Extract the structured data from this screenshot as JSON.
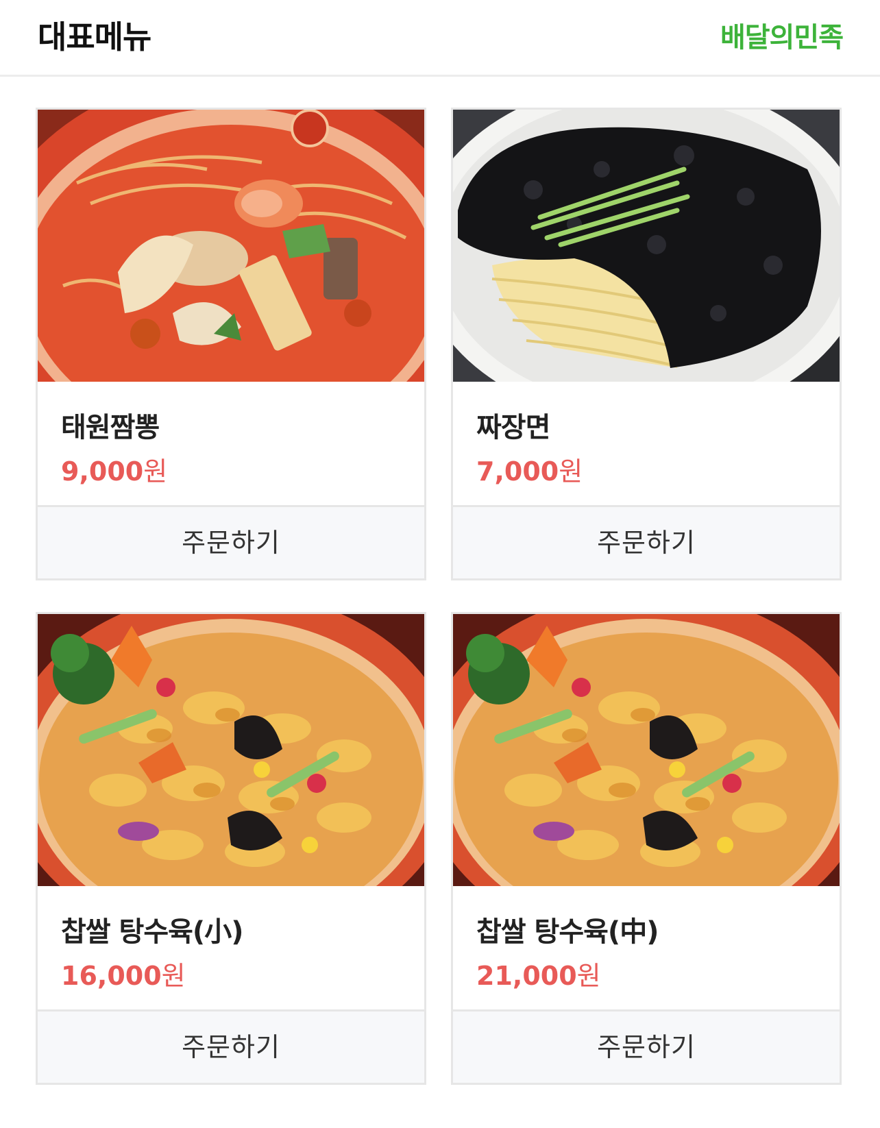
{
  "header": {
    "title": "대표메뉴",
    "brand": "배달의민족"
  },
  "menu": [
    {
      "name": "태원짬뽕",
      "price": "9,000",
      "currency": "원",
      "order_label": "주문하기",
      "photo": "jjamppong"
    },
    {
      "name": "짜장면",
      "price": "7,000",
      "currency": "원",
      "order_label": "주문하기",
      "photo": "jajangmyeon"
    },
    {
      "name": "찹쌀 탕수육(小)",
      "price": "16,000",
      "currency": "원",
      "order_label": "주문하기",
      "photo": "tangsuyuk"
    },
    {
      "name": "찹쌀 탕수육(中)",
      "price": "21,000",
      "currency": "원",
      "order_label": "주문하기",
      "photo": "tangsuyuk"
    }
  ],
  "colors": {
    "brand_green": "#3db33a",
    "price_red": "#e85a57",
    "button_bg": "#f7f8fa",
    "border": "#e6e6e6"
  }
}
